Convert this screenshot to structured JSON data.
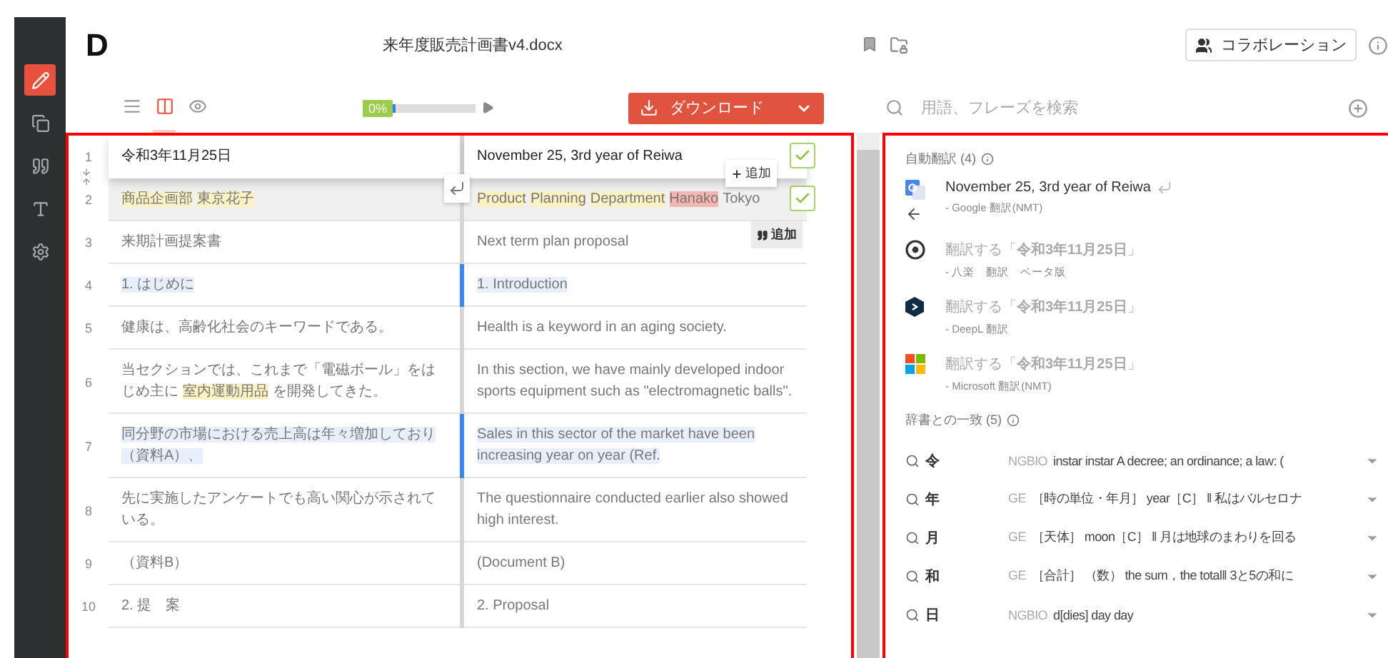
{
  "sidebar": {
    "items": [
      {
        "kind": "edit",
        "selected": true
      },
      {
        "kind": "documents",
        "selected": false
      },
      {
        "kind": "quote",
        "selected": false
      },
      {
        "kind": "text",
        "selected": false
      },
      {
        "kind": "settings",
        "selected": false
      }
    ]
  },
  "header": {
    "logo": "D",
    "file_name": "来年度販売計画書v4.docx",
    "collaboration_button": "コラボレーション"
  },
  "toolbar": {
    "view_modes": [
      {
        "kind": "lines",
        "selected": false
      },
      {
        "kind": "columns",
        "selected": true
      },
      {
        "kind": "preview",
        "selected": false
      }
    ],
    "progress": {
      "label": "0%",
      "level": 0.03
    },
    "download_button": "ダウンロード"
  },
  "search": {
    "placeholder": "用語、フレーズを検索"
  },
  "rows": [
    {
      "number": "1",
      "editing": true,
      "hovered": false,
      "selected": false,
      "confirmed": true,
      "source": [
        {
          "text": "令和3年11月25日",
          "kind": "plain"
        }
      ],
      "target": [
        {
          "text": "November 25, 3rd year of Reiwa",
          "kind": "plain"
        }
      ]
    },
    {
      "number": "2",
      "editing": false,
      "hovered": true,
      "selected": false,
      "confirmed": true,
      "source": [
        {
          "text": "商品企画部",
          "kind": "term"
        },
        {
          "text": "東京花子",
          "kind": "term"
        }
      ],
      "target": [
        {
          "text": "Product",
          "kind": "term"
        },
        {
          "text": "Planning",
          "kind": "term"
        },
        {
          "text": "Department",
          "kind": "term"
        },
        {
          "text": "Hanako",
          "kind": "name"
        },
        {
          "text": "Tokyo",
          "kind": "plain"
        }
      ]
    },
    {
      "number": "3",
      "editing": false,
      "hovered": false,
      "selected": false,
      "confirmed": false,
      "source": [
        {
          "text": "来期計画提案書",
          "kind": "plain"
        }
      ],
      "target": [
        {
          "text": "Next term plan proposal",
          "kind": "plain"
        }
      ]
    },
    {
      "number": "4",
      "editing": false,
      "hovered": false,
      "selected": true,
      "confirmed": false,
      "source": [
        {
          "text": "1. はじめに",
          "kind": "match"
        }
      ],
      "target": [
        {
          "text": "1. Introduction",
          "kind": "match"
        }
      ]
    },
    {
      "number": "5",
      "editing": false,
      "hovered": false,
      "selected": false,
      "confirmed": false,
      "source": [
        {
          "text": "健康は、高齢化社会のキーワードである。",
          "kind": "plain"
        }
      ],
      "target": [
        {
          "text": "Health is a keyword in an aging society.",
          "kind": "plain"
        }
      ]
    },
    {
      "number": "6",
      "editing": false,
      "hovered": false,
      "selected": false,
      "confirmed": false,
      "source": [
        {
          "text": "当セクションでは、これまで「電磁ボール」をはじめ主に",
          "kind": "plain"
        },
        {
          "text": "室内運動用品",
          "kind": "term"
        },
        {
          "text": "を開発してきた。",
          "kind": "plain"
        }
      ],
      "target": [
        {
          "text": "In this section, we have mainly developed indoor sports equipment such as \"electromagnetic balls\".",
          "kind": "plain"
        }
      ]
    },
    {
      "number": "7",
      "editing": false,
      "hovered": false,
      "selected": true,
      "confirmed": false,
      "source": [
        {
          "text": "同分野の市場における売上高は年々増加しており（資料A）、",
          "kind": "match"
        }
      ],
      "target": [
        {
          "text": "Sales in this sector of the market have been increasing year on year (Ref.",
          "kind": "match"
        }
      ]
    },
    {
      "number": "8",
      "editing": false,
      "hovered": false,
      "selected": false,
      "confirmed": false,
      "source": [
        {
          "text": "先に実施したアンケートでも高い関心が示されている。",
          "kind": "plain"
        }
      ],
      "target": [
        {
          "text": "The questionnaire conducted earlier also showed high interest.",
          "kind": "plain"
        }
      ]
    },
    {
      "number": "9",
      "editing": false,
      "hovered": false,
      "selected": false,
      "confirmed": false,
      "source": [
        {
          "text": "（資料B）",
          "kind": "plain"
        }
      ],
      "target": [
        {
          "text": "(Document B)",
          "kind": "plain"
        }
      ]
    },
    {
      "number": "10",
      "editing": false,
      "hovered": false,
      "selected": false,
      "confirmed": false,
      "source": [
        {
          "text": "2. 提　案",
          "kind": "plain"
        }
      ],
      "target": [
        {
          "text": "2. Proposal",
          "kind": "plain"
        }
      ]
    }
  ],
  "popups": {
    "add_term_button": "追加",
    "add_quote_button": "追加"
  },
  "machine_translation": {
    "heading": "自動翻訳 (4)",
    "items": [
      {
        "kind": "google",
        "text": "November 25, 3rd year of Reiwa",
        "source": "- Google 翻訳(NMT)",
        "available": true
      },
      {
        "kind": "yaraku",
        "text": "翻訳する「**令和3年11月25日**」",
        "source": "- 八楽　翻訳　ベータ版",
        "available": false
      },
      {
        "kind": "deepl",
        "text": "翻訳する「**令和3年11月25日**」",
        "source": "- DeepL 翻訳",
        "available": false
      },
      {
        "kind": "microsoft",
        "text": "翻訳する「**令和3年11月25日**」",
        "source": "- Microsoft 翻訳(NMT)",
        "available": false
      }
    ]
  },
  "dictionary": {
    "heading": "辞書との一致 (5)",
    "items": [
      {
        "term": "令",
        "source": "NGBIO",
        "definition": "instar instar A decree; an ordinance; a law: ("
      },
      {
        "term": "年",
        "source": "GE",
        "definition": "［時の単位・年月］ year［C］ ‖ 私はバルセロナ"
      },
      {
        "term": "月",
        "source": "GE",
        "definition": "［天体］ moon［C］ ‖ 月は地球のまわりを回る"
      },
      {
        "term": "和",
        "source": "GE",
        "definition": "［合計］ （数） the sum，the total‖ 3と5の和に"
      },
      {
        "term": "日",
        "source": "NGBIO",
        "definition": "d[dies] day day"
      }
    ]
  }
}
